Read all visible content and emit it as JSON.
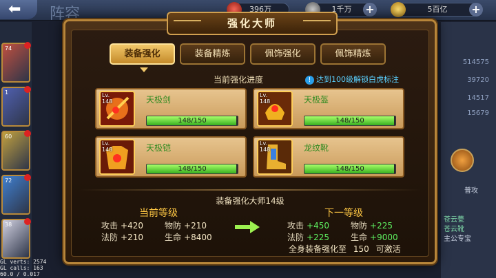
{
  "header": {
    "back_label": "⬅",
    "bg_title": "阵容",
    "resources": [
      {
        "value": "396万"
      },
      {
        "value": "1千万"
      },
      {
        "value": "5百亿"
      }
    ]
  },
  "heroes": [
    {
      "level": "74"
    },
    {
      "level": "1"
    },
    {
      "level": "60"
    },
    {
      "level": "72"
    },
    {
      "level": "38"
    }
  ],
  "right_stats": [
    "514575",
    "39720",
    "14517",
    "15679"
  ],
  "right_panel": {
    "skill_label": "普攻",
    "lines": [
      "苍云甍",
      "苍云靴",
      "主公专宝"
    ]
  },
  "debug": [
    "GL verts:   2574",
    "GL calls:    163",
    "60.0 / 0.017"
  ],
  "dialog": {
    "title": "强化大师",
    "tabs": [
      "装备强化",
      "装备精炼",
      "佩饰强化",
      "佩饰精炼"
    ],
    "active_tab": 0,
    "progress_title": "当前强化进度",
    "hint": "达到100级解锁白虎标注",
    "equipment": [
      {
        "name": "天极剑",
        "lv_label": "Lv.",
        "level": "148",
        "current": 148,
        "max": 150,
        "progress_text": "148/150"
      },
      {
        "name": "天极盔",
        "lv_label": "Lv.",
        "level": "148",
        "current": 148,
        "max": 150,
        "progress_text": "148/150"
      },
      {
        "name": "天极铠",
        "lv_label": "Lv.",
        "level": "148",
        "current": 148,
        "max": 150,
        "progress_text": "148/150"
      },
      {
        "name": "龙纹靴",
        "lv_label": "Lv.",
        "level": "148",
        "current": 148,
        "max": 150,
        "progress_text": "148/150"
      }
    ],
    "master_level": "装备强化大师14级",
    "current": {
      "title": "当前等级",
      "stats": [
        {
          "k": "攻击",
          "v": "+420"
        },
        {
          "k": "物防",
          "v": "+210"
        },
        {
          "k": "法防",
          "v": "+210"
        },
        {
          "k": "生命",
          "v": "+8400"
        }
      ]
    },
    "next": {
      "title": "下一等级",
      "stats": [
        {
          "k": "攻击",
          "v": "+450"
        },
        {
          "k": "物防",
          "v": "+225"
        },
        {
          "k": "法防",
          "v": "+225"
        },
        {
          "k": "生命",
          "v": "+9000"
        }
      ]
    },
    "footer": {
      "prefix": "全身装备强化至",
      "level": "150",
      "suffix": "可激活"
    }
  },
  "colors": {
    "accent_gold": "#f2c86a",
    "bar_green": "#38b020",
    "stat_green": "#5ef060",
    "title_yellow": "#ffc844"
  }
}
